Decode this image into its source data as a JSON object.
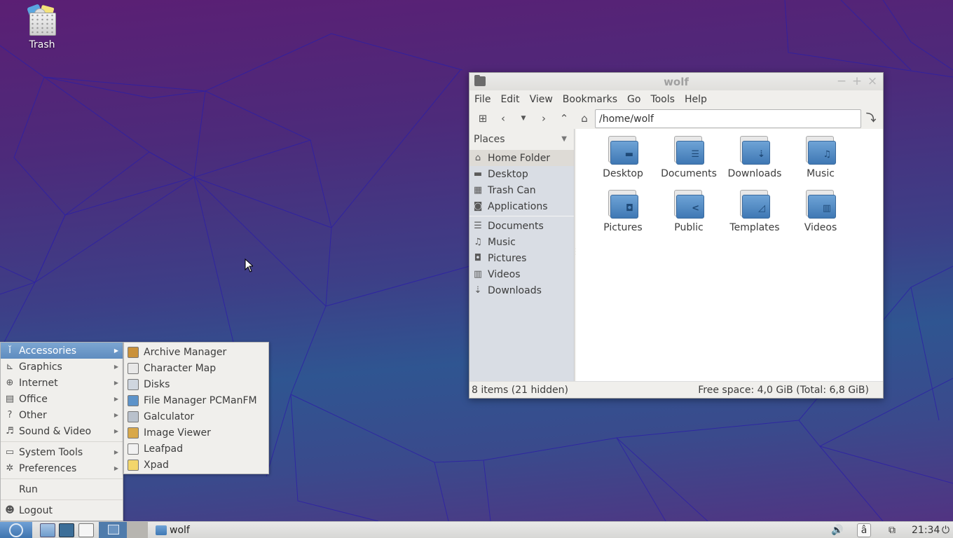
{
  "desktop": {
    "icons": [
      {
        "label": "Trash",
        "icon": "trash-icon"
      }
    ]
  },
  "file_manager": {
    "title": "wolf",
    "window_buttons": {
      "minimize": "−",
      "maximize": "+",
      "close": "×"
    },
    "menu": [
      "File",
      "Edit",
      "View",
      "Bookmarks",
      "Go",
      "Tools",
      "Help"
    ],
    "toolbar": {
      "new_tab_icon": "new-tab-icon",
      "back_icon": "back-icon",
      "history_icon": "history-dropdown-icon",
      "forward_icon": "forward-icon",
      "up_icon": "up-icon",
      "home_icon": "home-icon",
      "path": "/home/wolf",
      "go_icon": "go-icon"
    },
    "side_pane": {
      "header": "Places",
      "places": [
        {
          "label": "Home Folder",
          "icon": "home-icon",
          "glyph": "⌂",
          "active": true
        },
        {
          "label": "Desktop",
          "icon": "desktop-icon",
          "glyph": "▬"
        },
        {
          "label": "Trash Can",
          "icon": "trash-icon",
          "glyph": "▦"
        },
        {
          "label": "Applications",
          "icon": "applications-icon",
          "glyph": "◙"
        }
      ],
      "bookmarks": [
        {
          "label": "Documents",
          "icon": "documents-icon",
          "glyph": "☰"
        },
        {
          "label": "Music",
          "icon": "music-icon",
          "glyph": "♫"
        },
        {
          "label": "Pictures",
          "icon": "pictures-icon",
          "glyph": "◘"
        },
        {
          "label": "Videos",
          "icon": "videos-icon",
          "glyph": "▥"
        },
        {
          "label": "Downloads",
          "icon": "downloads-icon",
          "glyph": "⇣"
        }
      ]
    },
    "folders": [
      {
        "label": "Desktop",
        "emblem": "▬"
      },
      {
        "label": "Documents",
        "emblem": "☰"
      },
      {
        "label": "Downloads",
        "emblem": "⇣"
      },
      {
        "label": "Music",
        "emblem": "♫"
      },
      {
        "label": "Pictures",
        "emblem": "◘"
      },
      {
        "label": "Public",
        "emblem": "<"
      },
      {
        "label": "Templates",
        "emblem": "◿"
      },
      {
        "label": "Videos",
        "emblem": "▥"
      }
    ],
    "status": {
      "items": "8 items (21 hidden)",
      "free_space": "Free space: 4,0 GiB (Total: 6,8 GiB)"
    }
  },
  "start_menu": {
    "categories": [
      {
        "label": "Accessories",
        "glyph": "ǐ",
        "selected": true,
        "submenu": true
      },
      {
        "label": "Graphics",
        "glyph": "⊾",
        "submenu": true
      },
      {
        "label": "Internet",
        "glyph": "⊕",
        "submenu": true
      },
      {
        "label": "Office",
        "glyph": "▤",
        "submenu": true
      },
      {
        "label": "Other",
        "glyph": "?",
        "submenu": true
      },
      {
        "label": "Sound & Video",
        "glyph": "♬",
        "submenu": true
      }
    ],
    "system": [
      {
        "label": "System Tools",
        "glyph": "▭",
        "submenu": true
      },
      {
        "label": "Preferences",
        "glyph": "✲",
        "submenu": true
      }
    ],
    "run": "Run",
    "logout": {
      "label": "Logout",
      "glyph": "☻"
    },
    "accessories": [
      {
        "label": "Archive Manager",
        "color": "#c9913a"
      },
      {
        "label": "Character Map",
        "color": "#e8e8e8"
      },
      {
        "label": "Disks",
        "color": "#cfd6df"
      },
      {
        "label": "File Manager PCManFM",
        "color": "#5d93c9"
      },
      {
        "label": "Galculator",
        "color": "#b9c1cc"
      },
      {
        "label": "Image Viewer",
        "color": "#d8a84a"
      },
      {
        "label": "Leafpad",
        "color": "#f1f1f1"
      },
      {
        "label": "Xpad",
        "color": "#f3d66b"
      }
    ]
  },
  "taskbar": {
    "task_label": "wolf",
    "clock": "21:34",
    "keyboard_layout": "â",
    "volume_icon": "🔊",
    "network_icon": "⧉",
    "power_icon": "⏻"
  }
}
